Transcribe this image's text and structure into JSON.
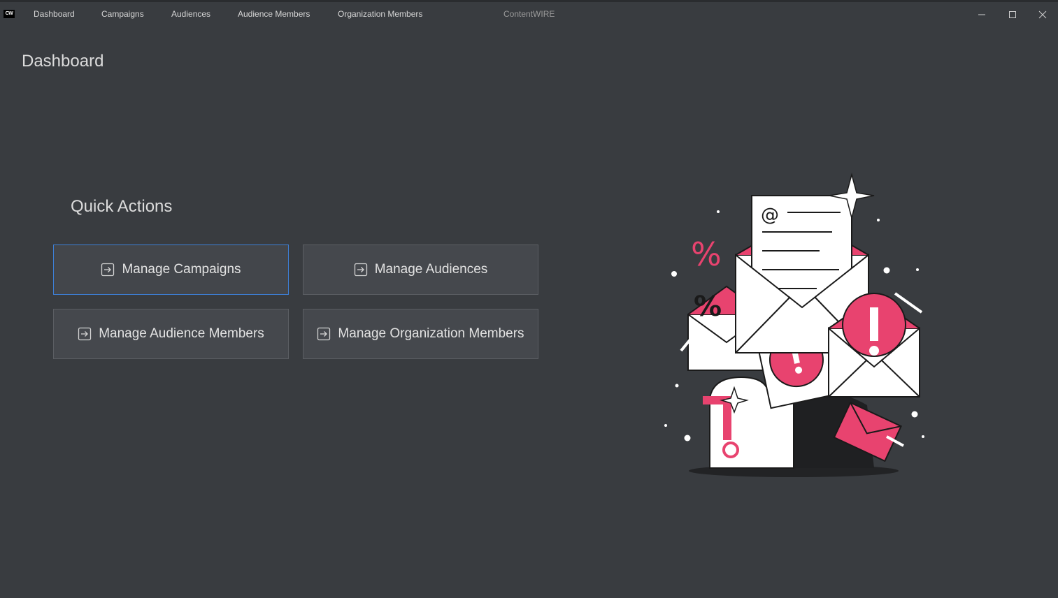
{
  "app": {
    "logo_text": "CW",
    "title": "ContentWIRE"
  },
  "nav": {
    "items": [
      {
        "label": "Dashboard"
      },
      {
        "label": "Campaigns"
      },
      {
        "label": "Audiences"
      },
      {
        "label": "Audience Members"
      },
      {
        "label": "Organization Members"
      }
    ]
  },
  "page": {
    "title": "Dashboard"
  },
  "quick_actions": {
    "title": "Quick Actions",
    "buttons": [
      {
        "label": "Manage Campaigns",
        "icon": "arrow-into-box-icon"
      },
      {
        "label": "Manage Audiences",
        "icon": "arrow-into-box-icon"
      },
      {
        "label": "Manage Audience Members",
        "icon": "arrow-into-box-icon"
      },
      {
        "label": "Manage Organization Members",
        "icon": "arrow-into-box-icon"
      }
    ]
  },
  "colors": {
    "background": "#393c40",
    "button": "#45484d",
    "focus_border": "#3d7fd6",
    "accent": "#e8436f"
  }
}
